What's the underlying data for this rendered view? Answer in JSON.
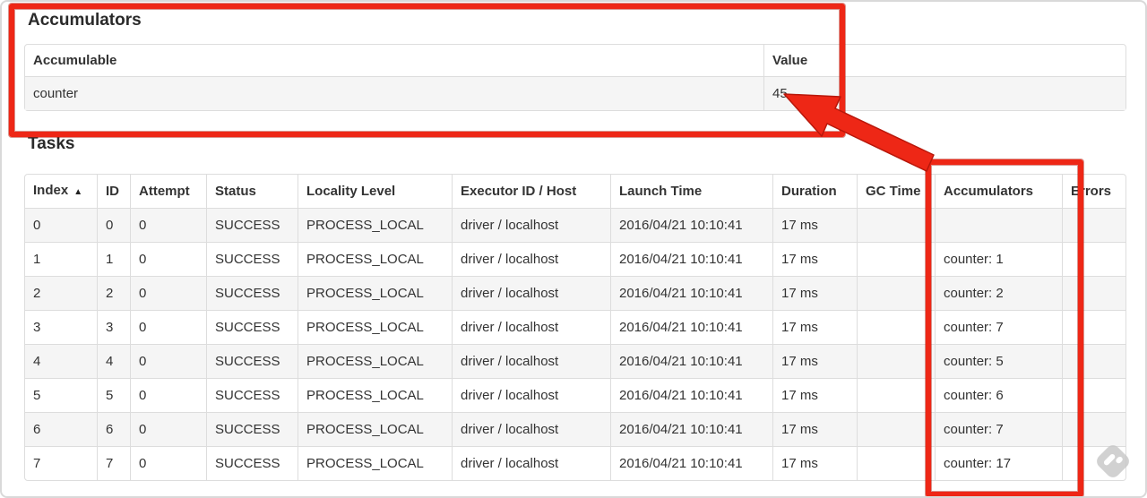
{
  "colors": {
    "annotation_red": "#ee2716",
    "table_border": "#dddddd",
    "row_stripe": "#f5f5f5",
    "text": "#333333"
  },
  "accumulators_section": {
    "title": "Accumulators",
    "columns": [
      "Accumulable",
      "Value"
    ],
    "rows": [
      [
        "counter",
        "45"
      ]
    ]
  },
  "tasks_section": {
    "title": "Tasks",
    "columns": [
      "Index",
      "ID",
      "Attempt",
      "Status",
      "Locality Level",
      "Executor ID / Host",
      "Launch Time",
      "Duration",
      "GC Time",
      "Accumulators",
      "Errors"
    ],
    "sort": {
      "column": "Index",
      "direction": "ascending",
      "icon": "▲"
    },
    "rows": [
      [
        "0",
        "0",
        "0",
        "SUCCESS",
        "PROCESS_LOCAL",
        "driver / localhost",
        "2016/04/21 10:10:41",
        "17 ms",
        "",
        "",
        ""
      ],
      [
        "1",
        "1",
        "0",
        "SUCCESS",
        "PROCESS_LOCAL",
        "driver / localhost",
        "2016/04/21 10:10:41",
        "17 ms",
        "",
        "counter: 1",
        ""
      ],
      [
        "2",
        "2",
        "0",
        "SUCCESS",
        "PROCESS_LOCAL",
        "driver / localhost",
        "2016/04/21 10:10:41",
        "17 ms",
        "",
        "counter: 2",
        ""
      ],
      [
        "3",
        "3",
        "0",
        "SUCCESS",
        "PROCESS_LOCAL",
        "driver / localhost",
        "2016/04/21 10:10:41",
        "17 ms",
        "",
        "counter: 7",
        ""
      ],
      [
        "4",
        "4",
        "0",
        "SUCCESS",
        "PROCESS_LOCAL",
        "driver / localhost",
        "2016/04/21 10:10:41",
        "17 ms",
        "",
        "counter: 5",
        ""
      ],
      [
        "5",
        "5",
        "0",
        "SUCCESS",
        "PROCESS_LOCAL",
        "driver / localhost",
        "2016/04/21 10:10:41",
        "17 ms",
        "",
        "counter: 6",
        ""
      ],
      [
        "6",
        "6",
        "0",
        "SUCCESS",
        "PROCESS_LOCAL",
        "driver / localhost",
        "2016/04/21 10:10:41",
        "17 ms",
        "",
        "counter: 7",
        ""
      ],
      [
        "7",
        "7",
        "0",
        "SUCCESS",
        "PROCESS_LOCAL",
        "driver / localhost",
        "2016/04/21 10:10:41",
        "17 ms",
        "",
        "counter: 17",
        ""
      ]
    ]
  }
}
